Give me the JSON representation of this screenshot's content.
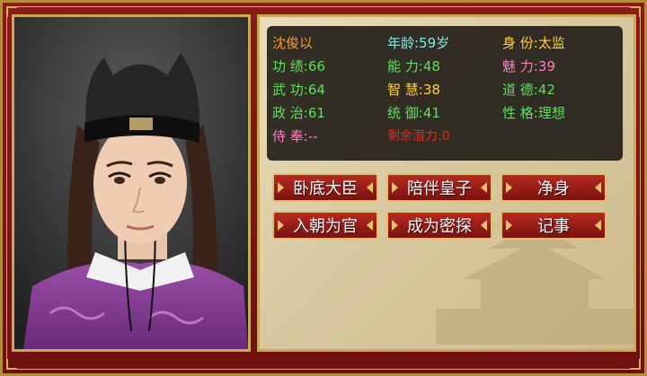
{
  "character": {
    "name": "沈俊以",
    "age": "年龄:59岁",
    "identity": "身 份:太监",
    "merit": "功 绩:66",
    "ability": "能 力:48",
    "charm": "魅 力:39",
    "martial": "武 功:64",
    "wisdom": "智 慧:38",
    "morality": "道 德:42",
    "politics": "政 治:61",
    "command": "统 御:41",
    "personality": "性 格:理想",
    "service": "侍 奉:--",
    "potential": "剩余潜力:0"
  },
  "actions": [
    {
      "label": "卧底大臣"
    },
    {
      "label": "陪伴皇子"
    },
    {
      "label": "净身"
    },
    {
      "label": "入朝为官"
    },
    {
      "label": "成为密探"
    },
    {
      "label": "记事"
    }
  ],
  "colors": {
    "name": "#ff9c2a",
    "age": "#7fe6e6",
    "identity": "#ffd23a",
    "green": "#5fe05f",
    "charm": "#ff7fc0",
    "wisdom": "#ffd23a",
    "potential": "#e02a1a",
    "service": "#ff7fc0"
  }
}
